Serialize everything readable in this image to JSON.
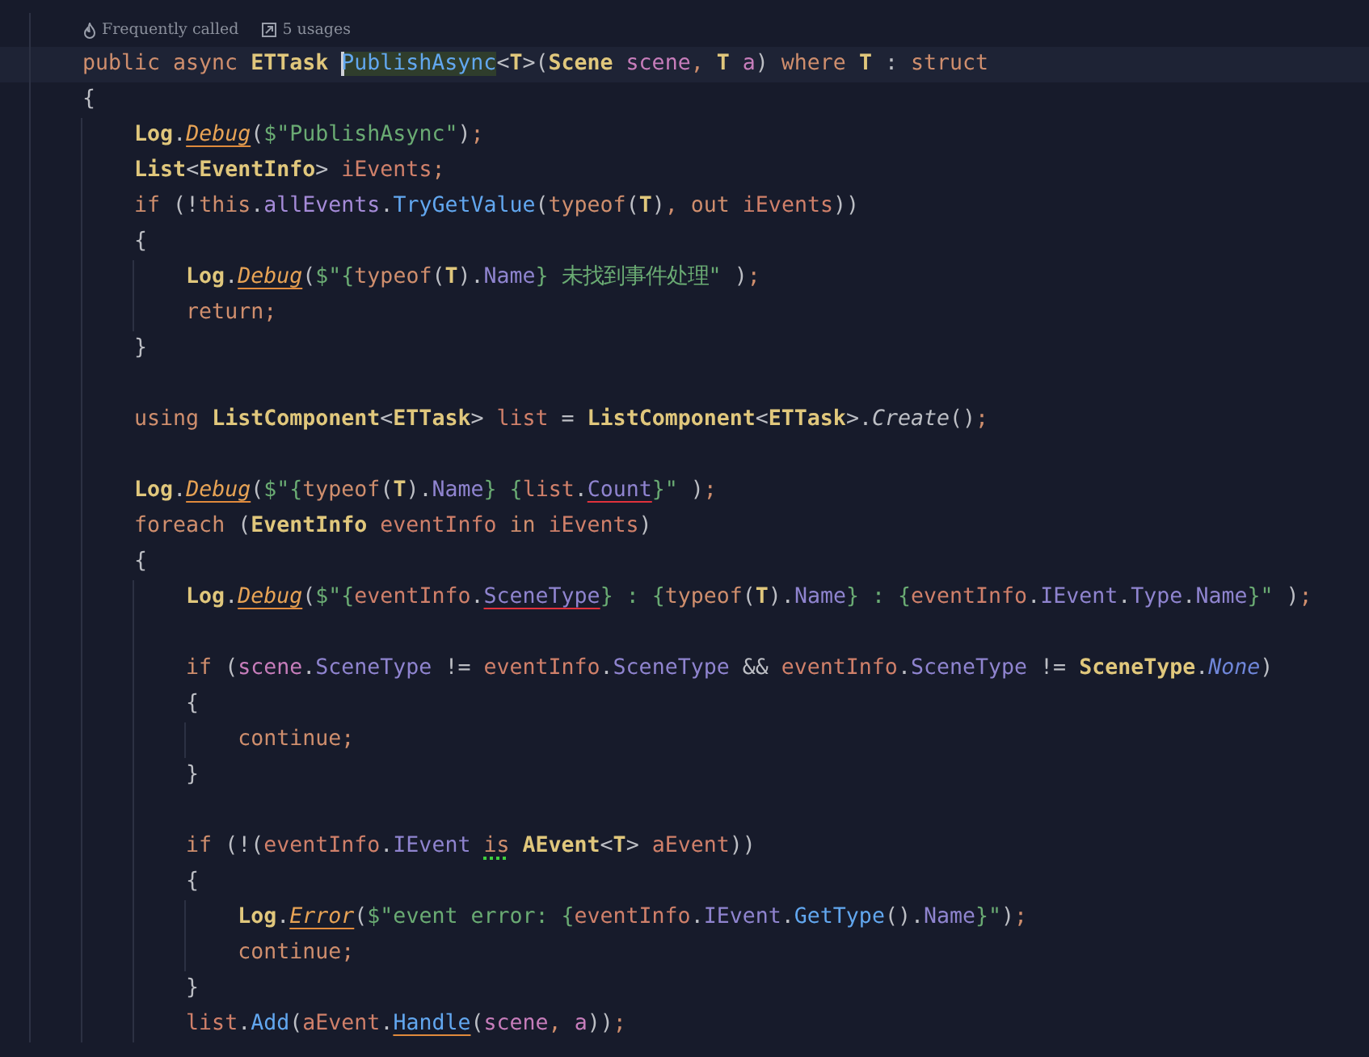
{
  "hints": [
    {
      "kind": "flame",
      "text": "Frequently called"
    },
    {
      "kind": "usages",
      "text": "5 usages"
    }
  ],
  "lines": [
    {
      "current": true,
      "tokens": [
        {
          "kind": "k",
          "text": "public async "
        },
        {
          "kind": "t",
          "text": "ETTask "
        },
        {
          "kind": "m",
          "text": "PublishAsync",
          "highlighted": true,
          "caret": true
        },
        {
          "kind": "x",
          "text": "<"
        },
        {
          "kind": "t",
          "text": "T"
        },
        {
          "kind": "x",
          "text": ">("
        },
        {
          "kind": "t",
          "text": "Scene "
        },
        {
          "kind": "p",
          "text": "scene"
        },
        {
          "kind": "k",
          "text": ", "
        },
        {
          "kind": "t",
          "text": "T "
        },
        {
          "kind": "p",
          "text": "a"
        },
        {
          "kind": "x",
          "text": ") "
        },
        {
          "kind": "k",
          "text": "where "
        },
        {
          "kind": "t",
          "text": "T"
        },
        {
          "kind": "x",
          "text": " : "
        },
        {
          "kind": "k",
          "text": "struct"
        }
      ]
    },
    {
      "current": false,
      "tokens": [
        {
          "kind": "x",
          "text": "{"
        }
      ]
    },
    {
      "current": false,
      "tokens": [
        {
          "kind": "t",
          "text": "    Log"
        },
        {
          "kind": "x",
          "text": "."
        },
        {
          "kind": "sm",
          "text": "Debug",
          "warning": true
        },
        {
          "kind": "x",
          "text": "("
        },
        {
          "kind": "s",
          "text": "$\"PublishAsync\""
        },
        {
          "kind": "x",
          "text": ")"
        },
        {
          "kind": "k",
          "text": ";"
        }
      ]
    },
    {
      "current": false,
      "tokens": [
        {
          "kind": "t",
          "text": "    List"
        },
        {
          "kind": "x",
          "text": "<"
        },
        {
          "kind": "t",
          "text": "EventInfo"
        },
        {
          "kind": "x",
          "text": "> "
        },
        {
          "kind": "l",
          "text": "iEvents"
        },
        {
          "kind": "k",
          "text": ";"
        }
      ]
    },
    {
      "current": false,
      "tokens": [
        {
          "kind": "k",
          "text": "    if"
        },
        {
          "kind": "x",
          "text": " (!"
        },
        {
          "kind": "k",
          "text": "this"
        },
        {
          "kind": "x",
          "text": "."
        },
        {
          "kind": "f",
          "text": "allEvents"
        },
        {
          "kind": "x",
          "text": "."
        },
        {
          "kind": "m",
          "text": "TryGetValue"
        },
        {
          "kind": "x",
          "text": "("
        },
        {
          "kind": "k",
          "text": "typeof"
        },
        {
          "kind": "x",
          "text": "("
        },
        {
          "kind": "t",
          "text": "T"
        },
        {
          "kind": "x",
          "text": ")"
        },
        {
          "kind": "k",
          "text": ", out "
        },
        {
          "kind": "l",
          "text": "iEvents"
        },
        {
          "kind": "x",
          "text": "))"
        }
      ]
    },
    {
      "current": false,
      "tokens": [
        {
          "kind": "x",
          "text": "    {"
        }
      ]
    },
    {
      "current": false,
      "tokens": [
        {
          "kind": "t",
          "text": "        Log"
        },
        {
          "kind": "x",
          "text": "."
        },
        {
          "kind": "sm",
          "text": "Debug",
          "warning": true
        },
        {
          "kind": "x",
          "text": "("
        },
        {
          "kind": "s",
          "text": "$\"{"
        },
        {
          "kind": "k",
          "text": "typeof"
        },
        {
          "kind": "x",
          "text": "("
        },
        {
          "kind": "t",
          "text": "T"
        },
        {
          "kind": "x",
          "text": ")."
        },
        {
          "kind": "pr",
          "text": "Name"
        },
        {
          "kind": "s",
          "text": "} 未找到事件处理\""
        },
        {
          "kind": "x",
          "text": " )"
        },
        {
          "kind": "k",
          "text": ";"
        }
      ]
    },
    {
      "current": false,
      "tokens": [
        {
          "kind": "k",
          "text": "        return;"
        }
      ]
    },
    {
      "current": false,
      "tokens": [
        {
          "kind": "x",
          "text": "    }"
        }
      ]
    },
    {
      "current": false,
      "gap_before": true,
      "tokens": [
        {
          "kind": "k",
          "text": "    using "
        },
        {
          "kind": "t",
          "text": "ListComponent"
        },
        {
          "kind": "x",
          "text": "<"
        },
        {
          "kind": "t",
          "text": "ETTask"
        },
        {
          "kind": "x",
          "text": "> "
        },
        {
          "kind": "l",
          "text": "list"
        },
        {
          "kind": "x",
          "text": " = "
        },
        {
          "kind": "t",
          "text": "ListComponent"
        },
        {
          "kind": "x",
          "text": "<"
        },
        {
          "kind": "t",
          "text": "ETTask"
        },
        {
          "kind": "x",
          "text": ">."
        },
        {
          "kind": "si",
          "text": "Create"
        },
        {
          "kind": "x",
          "text": "()"
        },
        {
          "kind": "k",
          "text": ";"
        }
      ]
    },
    {
      "current": false,
      "gap_before": true,
      "tokens": [
        {
          "kind": "t",
          "text": "    Log"
        },
        {
          "kind": "x",
          "text": "."
        },
        {
          "kind": "sm",
          "text": "Debug",
          "warning": true
        },
        {
          "kind": "x",
          "text": "("
        },
        {
          "kind": "s",
          "text": "$\"{"
        },
        {
          "kind": "k",
          "text": "typeof"
        },
        {
          "kind": "x",
          "text": "("
        },
        {
          "kind": "t",
          "text": "T"
        },
        {
          "kind": "x",
          "text": ")."
        },
        {
          "kind": "pr",
          "text": "Name"
        },
        {
          "kind": "s",
          "text": "} {"
        },
        {
          "kind": "l",
          "text": "list"
        },
        {
          "kind": "x",
          "text": "."
        },
        {
          "kind": "pr",
          "text": "Count",
          "error": true
        },
        {
          "kind": "s",
          "text": "}\""
        },
        {
          "kind": "x",
          "text": " )"
        },
        {
          "kind": "k",
          "text": ";"
        }
      ]
    },
    {
      "current": false,
      "tokens": [
        {
          "kind": "k",
          "text": "    foreach"
        },
        {
          "kind": "x",
          "text": " ("
        },
        {
          "kind": "t",
          "text": "EventInfo "
        },
        {
          "kind": "l",
          "text": "eventInfo"
        },
        {
          "kind": "k",
          "text": " in "
        },
        {
          "kind": "l",
          "text": "iEvents"
        },
        {
          "kind": "x",
          "text": ")"
        }
      ]
    },
    {
      "current": false,
      "tokens": [
        {
          "kind": "x",
          "text": "    {"
        }
      ]
    },
    {
      "current": false,
      "tokens": [
        {
          "kind": "t",
          "text": "        Log"
        },
        {
          "kind": "x",
          "text": "."
        },
        {
          "kind": "sm",
          "text": "Debug",
          "warning": true
        },
        {
          "kind": "x",
          "text": "("
        },
        {
          "kind": "s",
          "text": "$\"{"
        },
        {
          "kind": "l",
          "text": "eventInfo"
        },
        {
          "kind": "x",
          "text": "."
        },
        {
          "kind": "pr",
          "text": "SceneType",
          "error": true
        },
        {
          "kind": "s",
          "text": "} : {"
        },
        {
          "kind": "k",
          "text": "typeof"
        },
        {
          "kind": "x",
          "text": "("
        },
        {
          "kind": "t",
          "text": "T"
        },
        {
          "kind": "x",
          "text": ")."
        },
        {
          "kind": "pr",
          "text": "Name"
        },
        {
          "kind": "s",
          "text": "} : {"
        },
        {
          "kind": "l",
          "text": "eventInfo"
        },
        {
          "kind": "x",
          "text": "."
        },
        {
          "kind": "pr",
          "text": "IEvent"
        },
        {
          "kind": "x",
          "text": "."
        },
        {
          "kind": "pr",
          "text": "Type"
        },
        {
          "kind": "x",
          "text": "."
        },
        {
          "kind": "pr",
          "text": "Name"
        },
        {
          "kind": "s",
          "text": "}\""
        },
        {
          "kind": "x",
          "text": " )"
        },
        {
          "kind": "k",
          "text": ";"
        }
      ]
    },
    {
      "current": false,
      "gap_before": true,
      "tokens": [
        {
          "kind": "k",
          "text": "        if"
        },
        {
          "kind": "x",
          "text": " ("
        },
        {
          "kind": "p",
          "text": "scene"
        },
        {
          "kind": "x",
          "text": "."
        },
        {
          "kind": "pr",
          "text": "SceneType"
        },
        {
          "kind": "x",
          "text": " != "
        },
        {
          "kind": "l",
          "text": "eventInfo"
        },
        {
          "kind": "x",
          "text": "."
        },
        {
          "kind": "pr",
          "text": "SceneType"
        },
        {
          "kind": "x",
          "text": " && "
        },
        {
          "kind": "l",
          "text": "eventInfo"
        },
        {
          "kind": "x",
          "text": "."
        },
        {
          "kind": "pr",
          "text": "SceneType"
        },
        {
          "kind": "x",
          "text": " != "
        },
        {
          "kind": "t",
          "text": "SceneType"
        },
        {
          "kind": "x",
          "text": "."
        },
        {
          "kind": "e",
          "text": "None"
        },
        {
          "kind": "x",
          "text": ")"
        }
      ]
    },
    {
      "current": false,
      "tokens": [
        {
          "kind": "x",
          "text": "        {"
        }
      ]
    },
    {
      "current": false,
      "tokens": [
        {
          "kind": "k",
          "text": "            continue;"
        }
      ]
    },
    {
      "current": false,
      "tokens": [
        {
          "kind": "x",
          "text": "        }"
        }
      ]
    },
    {
      "current": false,
      "gap_before": true,
      "tokens": [
        {
          "kind": "k",
          "text": "        if"
        },
        {
          "kind": "x",
          "text": " (!("
        },
        {
          "kind": "l",
          "text": "eventInfo"
        },
        {
          "kind": "x",
          "text": "."
        },
        {
          "kind": "pr",
          "text": "IEvent "
        },
        {
          "kind": "k",
          "text": "is",
          "hint": true
        },
        {
          "kind": "t",
          "text": " AEvent"
        },
        {
          "kind": "x",
          "text": "<"
        },
        {
          "kind": "t",
          "text": "T"
        },
        {
          "kind": "x",
          "text": "> "
        },
        {
          "kind": "l",
          "text": "aEvent"
        },
        {
          "kind": "x",
          "text": "))"
        }
      ]
    },
    {
      "current": false,
      "tokens": [
        {
          "kind": "x",
          "text": "        {"
        }
      ]
    },
    {
      "current": false,
      "tokens": [
        {
          "kind": "t",
          "text": "            Log"
        },
        {
          "kind": "x",
          "text": "."
        },
        {
          "kind": "sm",
          "text": "Error",
          "warning": true
        },
        {
          "kind": "x",
          "text": "("
        },
        {
          "kind": "s",
          "text": "$\"event error: {"
        },
        {
          "kind": "l",
          "text": "eventInfo"
        },
        {
          "kind": "x",
          "text": "."
        },
        {
          "kind": "pr",
          "text": "IEvent"
        },
        {
          "kind": "x",
          "text": "."
        },
        {
          "kind": "m",
          "text": "GetType"
        },
        {
          "kind": "x",
          "text": "()."
        },
        {
          "kind": "pr",
          "text": "Name"
        },
        {
          "kind": "s",
          "text": "}\""
        },
        {
          "kind": "x",
          "text": ")"
        },
        {
          "kind": "k",
          "text": ";"
        }
      ]
    },
    {
      "current": false,
      "tokens": [
        {
          "kind": "k",
          "text": "            continue;"
        }
      ]
    },
    {
      "current": false,
      "tokens": [
        {
          "kind": "x",
          "text": "        }"
        }
      ]
    },
    {
      "current": false,
      "tokens": [
        {
          "kind": "l",
          "text": "        list"
        },
        {
          "kind": "x",
          "text": "."
        },
        {
          "kind": "m",
          "text": "Add"
        },
        {
          "kind": "x",
          "text": "("
        },
        {
          "kind": "l",
          "text": "aEvent"
        },
        {
          "kind": "x",
          "text": "."
        },
        {
          "kind": "m",
          "text": "Handle",
          "warning": true
        },
        {
          "kind": "x",
          "text": "("
        },
        {
          "kind": "p",
          "text": "scene"
        },
        {
          "kind": "k",
          "text": ", "
        },
        {
          "kind": "p",
          "text": "a"
        },
        {
          "kind": "x",
          "text": "))"
        },
        {
          "kind": "k",
          "text": ";"
        }
      ]
    }
  ]
}
